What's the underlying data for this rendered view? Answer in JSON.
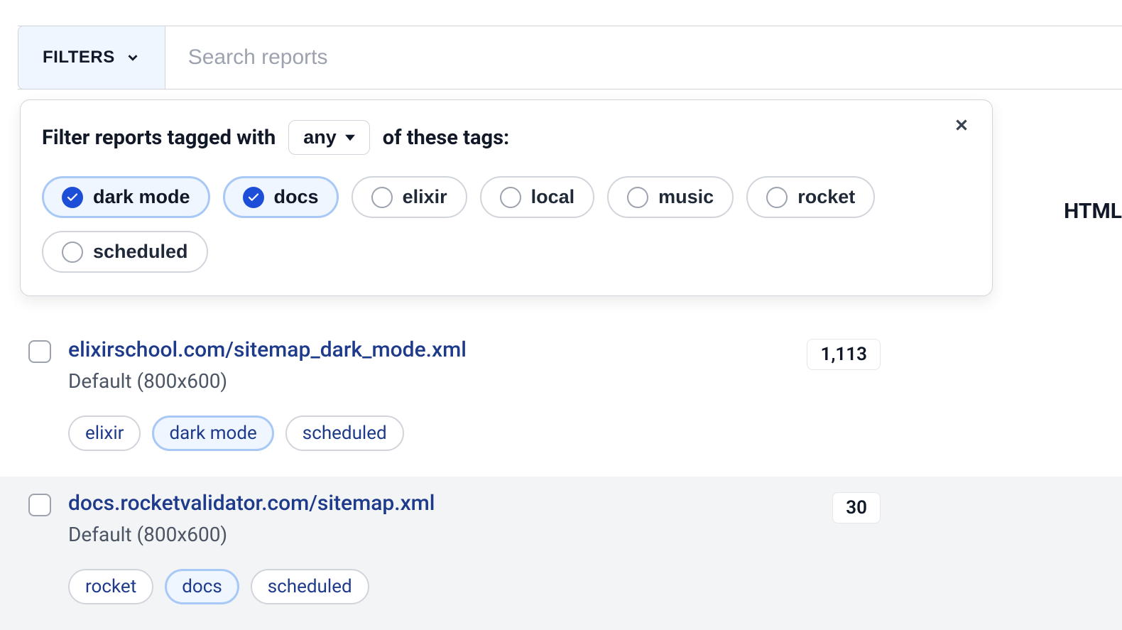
{
  "topbar": {
    "filters_label": "FILTERS",
    "search_placeholder": "Search reports"
  },
  "filter_panel": {
    "prefix": "Filter reports tagged with",
    "mode": "any",
    "suffix": "of these tags:",
    "tags": [
      {
        "label": "dark mode",
        "selected": true
      },
      {
        "label": "docs",
        "selected": true
      },
      {
        "label": "elixir",
        "selected": false
      },
      {
        "label": "local",
        "selected": false
      },
      {
        "label": "music",
        "selected": false
      },
      {
        "label": "rocket",
        "selected": false
      },
      {
        "label": "scheduled",
        "selected": false
      }
    ]
  },
  "side_label": "HTML",
  "reports": [
    {
      "url": "elixirschool.com/sitemap_dark_mode.xml",
      "subtitle": "Default (800x600)",
      "count": "1,113",
      "tags": [
        {
          "label": "elixir",
          "active": false
        },
        {
          "label": "dark mode",
          "active": true
        },
        {
          "label": "scheduled",
          "active": false
        }
      ],
      "alt": false
    },
    {
      "url": "docs.rocketvalidator.com/sitemap.xml",
      "subtitle": "Default (800x600)",
      "count": "30",
      "tags": [
        {
          "label": "rocket",
          "active": false
        },
        {
          "label": "docs",
          "active": true
        },
        {
          "label": "scheduled",
          "active": false
        }
      ],
      "alt": true
    }
  ]
}
